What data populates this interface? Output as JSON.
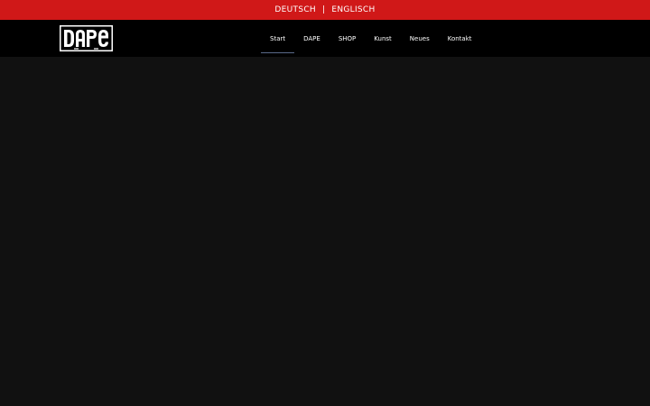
{
  "language_bar": {
    "german": "DEUTSCH",
    "separator": "|",
    "english": "ENGLISCH"
  },
  "logo": {
    "text": "DAPE"
  },
  "nav": {
    "items": [
      {
        "label": "Start"
      },
      {
        "label": "DAPE"
      },
      {
        "label": "SHOP"
      },
      {
        "label": "Kunst"
      },
      {
        "label": "Neues"
      },
      {
        "label": "Kontakt"
      }
    ]
  },
  "colors": {
    "language_bar_bg": "#d01818",
    "header_bg": "#000000",
    "page_bg": "#111111",
    "active_underline": "#5a6a8a"
  }
}
